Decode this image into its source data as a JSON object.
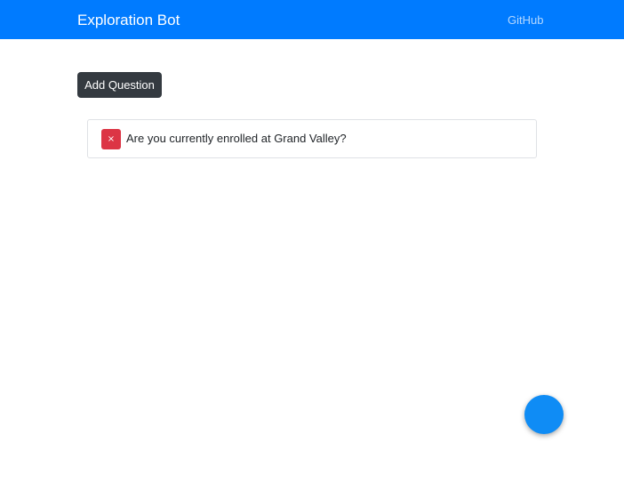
{
  "navbar": {
    "brand": "Exploration Bot",
    "github_link": "GitHub"
  },
  "toolbar": {
    "add_question_label": "Add Question"
  },
  "questions": [
    {
      "text": "Are you currently enrolled at Grand Valley?",
      "delete_glyph": "×"
    }
  ],
  "fab": {
    "icon": "chat-bubble-icon"
  },
  "colors": {
    "navbar": "#007bff",
    "add_button": "#343a40",
    "delete_button": "#dc3545",
    "fab": "#0f8cf5"
  }
}
